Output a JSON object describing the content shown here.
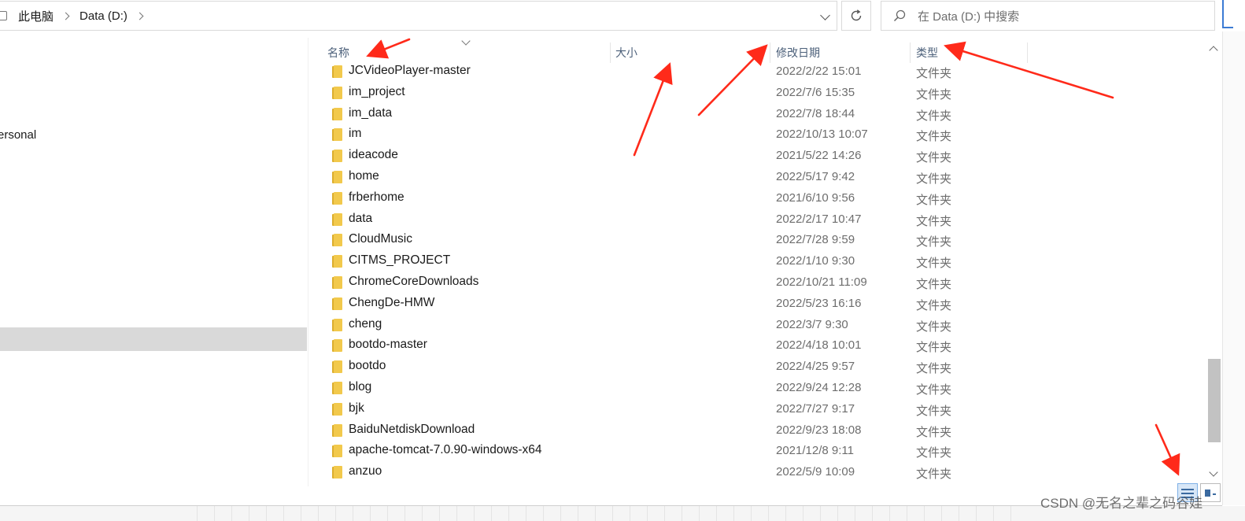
{
  "breadcrumb": {
    "items": [
      "此电脑",
      "Data (D:)"
    ]
  },
  "search": {
    "placeholder": "在 Data (D:) 中搜索"
  },
  "nav": {
    "partial_label": "ersonal"
  },
  "columns": {
    "name": "名称",
    "size": "大小",
    "date": "修改日期",
    "type": "类型"
  },
  "files": [
    {
      "name": "JCVideoPlayer-master",
      "date": "2022/2/22 15:01",
      "type": "文件夹"
    },
    {
      "name": "im_project",
      "date": "2022/7/6 15:35",
      "type": "文件夹"
    },
    {
      "name": "im_data",
      "date": "2022/7/8 18:44",
      "type": "文件夹"
    },
    {
      "name": "im",
      "date": "2022/10/13 10:07",
      "type": "文件夹"
    },
    {
      "name": "ideacode",
      "date": "2021/5/22 14:26",
      "type": "文件夹"
    },
    {
      "name": "home",
      "date": "2022/5/17 9:42",
      "type": "文件夹"
    },
    {
      "name": "frberhome",
      "date": "2021/6/10 9:56",
      "type": "文件夹"
    },
    {
      "name": "data",
      "date": "2022/2/17 10:47",
      "type": "文件夹"
    },
    {
      "name": "CloudMusic",
      "date": "2022/7/28 9:59",
      "type": "文件夹"
    },
    {
      "name": "CITMS_PROJECT",
      "date": "2022/1/10 9:30",
      "type": "文件夹"
    },
    {
      "name": "ChromeCoreDownloads",
      "date": "2022/10/21 11:09",
      "type": "文件夹"
    },
    {
      "name": "ChengDe-HMW",
      "date": "2022/5/23 16:16",
      "type": "文件夹"
    },
    {
      "name": "cheng",
      "date": "2022/3/7 9:30",
      "type": "文件夹"
    },
    {
      "name": "bootdo-master",
      "date": "2022/4/18 10:01",
      "type": "文件夹"
    },
    {
      "name": "bootdo",
      "date": "2022/4/25 9:57",
      "type": "文件夹"
    },
    {
      "name": "blog",
      "date": "2022/9/24 12:28",
      "type": "文件夹"
    },
    {
      "name": "bjk",
      "date": "2022/7/27 9:17",
      "type": "文件夹"
    },
    {
      "name": "BaiduNetdiskDownload",
      "date": "2022/9/23 18:08",
      "type": "文件夹"
    },
    {
      "name": "apache-tomcat-7.0.90-windows-x64",
      "date": "2021/12/8 9:11",
      "type": "文件夹"
    },
    {
      "name": "anzuo",
      "date": "2022/5/9 10:09",
      "type": "文件夹"
    }
  ],
  "watermark": "CSDN @无名之辈之码谷娃",
  "colors": {
    "folder": "#f2c94c",
    "folder_tab": "#dcae2e",
    "arrow": "#ff2a1a",
    "header_text": "#4c607a",
    "selection": "#d9d9d9"
  },
  "icons": {
    "refresh": "refresh-icon",
    "search": "search-icon",
    "folder": "folder-icon"
  }
}
